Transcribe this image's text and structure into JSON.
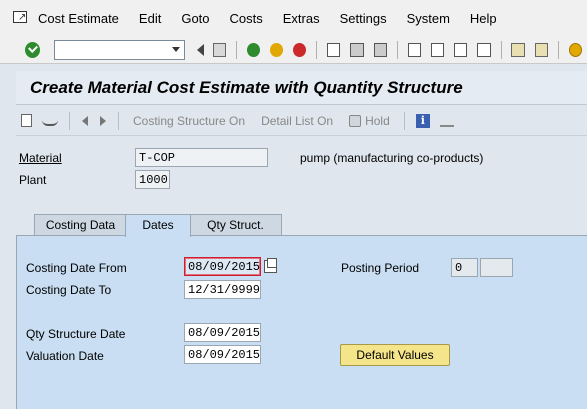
{
  "menubar": {
    "items": [
      "Cost Estimate",
      "Edit",
      "Goto",
      "Costs",
      "Extras",
      "Settings",
      "System",
      "Help"
    ]
  },
  "toolbar": {
    "command_field": "",
    "icons": [
      "check-icon",
      "back-triangle-icon",
      "save-icon",
      "back-icon",
      "exit-icon",
      "cancel-icon",
      "print-icon",
      "find-icon",
      "find-next-icon",
      "first-page-icon",
      "previous-page-icon",
      "next-page-icon",
      "last-page-icon",
      "create-session-icon",
      "shortcut-icon",
      "help-icon"
    ]
  },
  "title": "Create Material Cost Estimate with Quantity Structure",
  "app_toolbar": {
    "costing_structure_on": "Costing Structure On",
    "detail_list_on": "Detail List On",
    "hold": "Hold"
  },
  "header": {
    "material_label": "Material",
    "material_value": "T-COP",
    "material_desc": "pump  (manufacturing co-products)",
    "plant_label": "Plant",
    "plant_value": "1000"
  },
  "tabs": [
    {
      "label": "Costing Data"
    },
    {
      "label": "Dates"
    },
    {
      "label": "Qty Struct."
    }
  ],
  "dates": {
    "costing_date_from_label": "Costing Date From",
    "costing_date_from": "08/09/2015",
    "costing_date_to_label": "Costing Date To",
    "costing_date_to": "12/31/9999",
    "posting_period_label": "Posting Period",
    "posting_period": "0",
    "posting_year": "",
    "qty_structure_date_label": "Qty Structure Date",
    "qty_structure_date": "08/09/2015",
    "valuation_date_label": "Valuation Date",
    "valuation_date": "08/09/2015",
    "default_values_button": "Default Values"
  },
  "colors": {
    "background": "#dfe6ed",
    "tab_panel": "#c9def2",
    "button_yellow": "#f5e58a",
    "focus_border": "#d02030"
  }
}
